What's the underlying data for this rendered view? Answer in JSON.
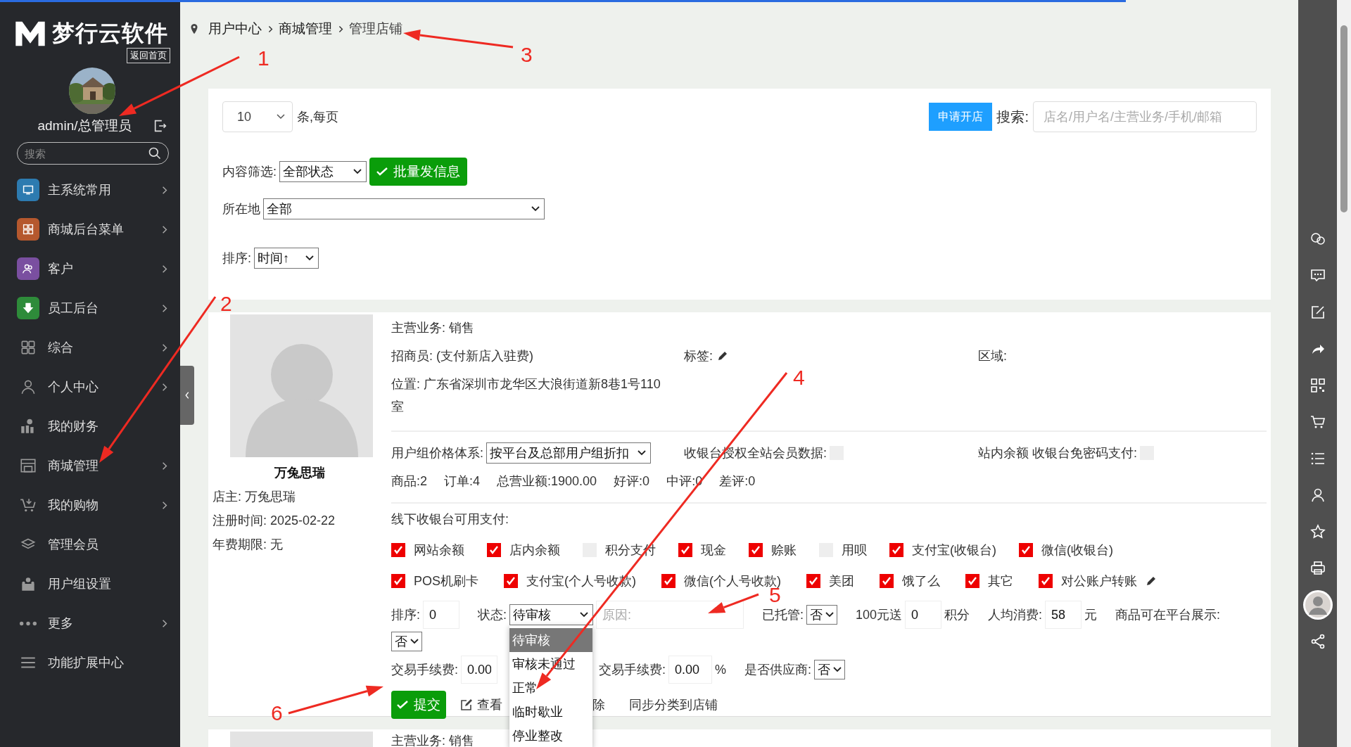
{
  "sidebar": {
    "logo": "梦行云软件",
    "home_link": "返回首页",
    "user": "admin/总管理员",
    "search": {
      "placeholder": "搜索"
    },
    "items": [
      {
        "label": "主系统常用",
        "color": "#2d7bb0",
        "has_submenu": true
      },
      {
        "label": "商城后台菜单",
        "color": "#b5582e",
        "has_submenu": true
      },
      {
        "label": "客户",
        "color": "#7a4fa0",
        "has_submenu": true
      },
      {
        "label": "员工后台",
        "color": "#2e8b3a",
        "has_submenu": true
      },
      {
        "label": "综合",
        "has_submenu": true
      },
      {
        "label": "个人中心",
        "has_submenu": true
      },
      {
        "label": "我的财务",
        "has_submenu": false
      },
      {
        "label": "商城管理",
        "has_submenu": true
      },
      {
        "label": "我的购物",
        "has_submenu": true
      },
      {
        "label": "管理会员",
        "has_submenu": false
      },
      {
        "label": "用户组设置",
        "has_submenu": false
      },
      {
        "label": "更多",
        "has_submenu": true
      },
      {
        "label": "功能扩展中心",
        "has_submenu": false
      }
    ]
  },
  "breadcrumb": [
    "用户中心",
    "商城管理",
    "管理店铺"
  ],
  "toolbar": {
    "page_size": "10",
    "page_size_suffix": "条,每页",
    "apply_button": "申请开店",
    "search_label": "搜索:",
    "search_placeholder": "店名/用户名/主营业务/手机/邮箱"
  },
  "filters": {
    "content_filter": {
      "label": "内容筛选:",
      "value": "全部状态"
    },
    "bulk_button": "批量发信息",
    "location": {
      "label": "所在地",
      "value": "全部"
    },
    "sort": {
      "label": "排序:",
      "value": "时间↑"
    }
  },
  "shop": {
    "name": "万兔思瑞",
    "owner": "店主: 万兔思瑞",
    "registered": "注册时间: 2025-02-22",
    "fee_expiry": "年费期限: 无",
    "business": "主营业务: 销售",
    "recruiter": "招商员: (支付新店入驻费)",
    "tag_label": "标签:",
    "region_label": "区域:",
    "location": "位置: 广东省深圳市龙华区大浪街道新8巷1号110室",
    "price_system": {
      "label": "用户组价格体系:",
      "value": "按平台及总部用户组折扣"
    },
    "cashier_auth": {
      "label": "收银台授权全站会员数据:",
      "checked": false
    },
    "passwordless": {
      "label": "站内余额 收银台免密码支付:",
      "checked": false
    },
    "stats": [
      "商品:2",
      "订单:4",
      "总营业额:1900.00",
      "好评:0",
      "中评:0",
      "差评:0"
    ],
    "payments_title": "线下收银台可用支付:",
    "payment_rows": [
      [
        {
          "label": "网站余额",
          "checked": true
        },
        {
          "label": "店内余额",
          "checked": true
        },
        {
          "label": "积分支付",
          "checked": false
        },
        {
          "label": "现金",
          "checked": true
        },
        {
          "label": "赊账",
          "checked": true
        },
        {
          "label": "用呗",
          "checked": false
        },
        {
          "label": "支付宝(收银台)",
          "checked": true
        },
        {
          "label": "微信(收银台)",
          "checked": true
        }
      ],
      [
        {
          "label": "POS机刷卡",
          "checked": true
        },
        {
          "label": "支付宝(个人号收款)",
          "checked": true
        },
        {
          "label": "微信(个人号收款)",
          "checked": true
        },
        {
          "label": "美团",
          "checked": true
        },
        {
          "label": "饿了么",
          "checked": true
        },
        {
          "label": "其它",
          "checked": true
        },
        {
          "label": "对公账户转账",
          "checked": true,
          "editable": true
        }
      ]
    ],
    "sort": {
      "label": "排序:",
      "value": "0"
    },
    "status": {
      "label": "状态:",
      "value": "待审核",
      "options": [
        {
          "label": "待审核",
          "selected": true
        },
        {
          "label": "审核未通过",
          "selected": false
        },
        {
          "label": "正常",
          "selected": false
        },
        {
          "label": "临时歇业",
          "selected": false
        },
        {
          "label": "停业整改",
          "selected": false
        }
      ]
    },
    "reason_placeholder": "原因:",
    "hosted": {
      "label": "已托管:",
      "value": "否"
    },
    "gift": {
      "label": "100元送",
      "value": "0",
      "suffix": "积分"
    },
    "avg_spend": {
      "label": "人均消费:",
      "value": "58",
      "suffix": "元"
    },
    "platform_display": {
      "label": "商品可在平台展示:",
      "value": "否"
    },
    "fee1": {
      "label": "交易手续费:",
      "value": "0.00"
    },
    "fee2": {
      "label": "交易手续费:",
      "value": "0.00",
      "suffix": "%"
    },
    "supplier": {
      "label": "是否供应商:",
      "value": "否"
    },
    "submit": "提交",
    "view_link": "查看",
    "delete_fragment": "除",
    "sync_link": "同步分类到店铺"
  },
  "next_shop": {
    "business": "主营业务: 销售"
  },
  "annotations": [
    {
      "label": "1"
    },
    {
      "label": "2"
    },
    {
      "label": "3"
    },
    {
      "label": "4"
    },
    {
      "label": "5"
    },
    {
      "label": "6"
    }
  ]
}
